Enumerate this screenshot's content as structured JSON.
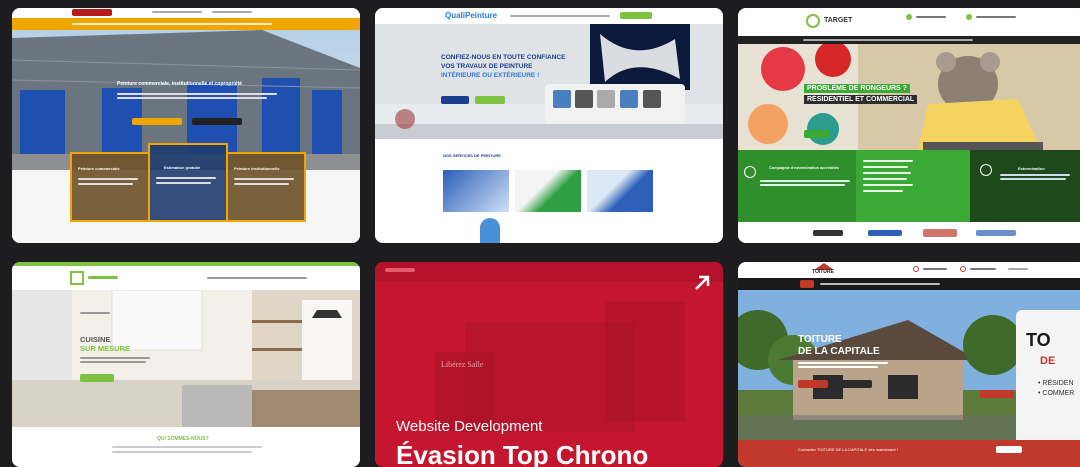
{
  "cards": [
    {
      "hero_text": "Peinture commerciale, institutionnelle et copropriété",
      "boxes": [
        "Peinture commerciale",
        "Estimation gratuite",
        "Peinture institutionnelle"
      ]
    },
    {
      "logo": "QualiPeinture",
      "hero_line1": "CONFIEZ-NOUS EN TOUTE CONFIANCE",
      "hero_line2": "VOS TRAVAUX DE PEINTURE",
      "hero_line3": "INTÉRIEURE OU EXTÉRIEURE !",
      "services_title": "NOS SERVICES DE PEINTURE"
    },
    {
      "logo": "TARGET",
      "hero_line1": "PROBLÈME DE RONGEURS ?",
      "hero_line2": "RÉSIDENTIEL ET COMMERCIAL",
      "box_title": "Compagnie d'extermination accrédités",
      "box2_title": "Extermination"
    },
    {
      "hero_line1": "CUISINE",
      "hero_line2": "SUR MESURE",
      "section_title": "QUI SOMMES-NOUS?"
    },
    {
      "overlay_small": "Libérez Salle",
      "label": "Website Development",
      "title": "Évasion Top Chrono",
      "accent": "#c4162f"
    },
    {
      "logo": "TOITURE",
      "hero_line1": "TOITURE",
      "hero_line2": "DE LA CAPITALE",
      "truck_text1": "TO",
      "truck_text2": "DE",
      "truck_text3": "• RÉSIDEN",
      "truck_text4": "• COMMER",
      "footer_strip": "Contactez TOITURE DE LA CAPITALE dès maintenant !"
    }
  ]
}
